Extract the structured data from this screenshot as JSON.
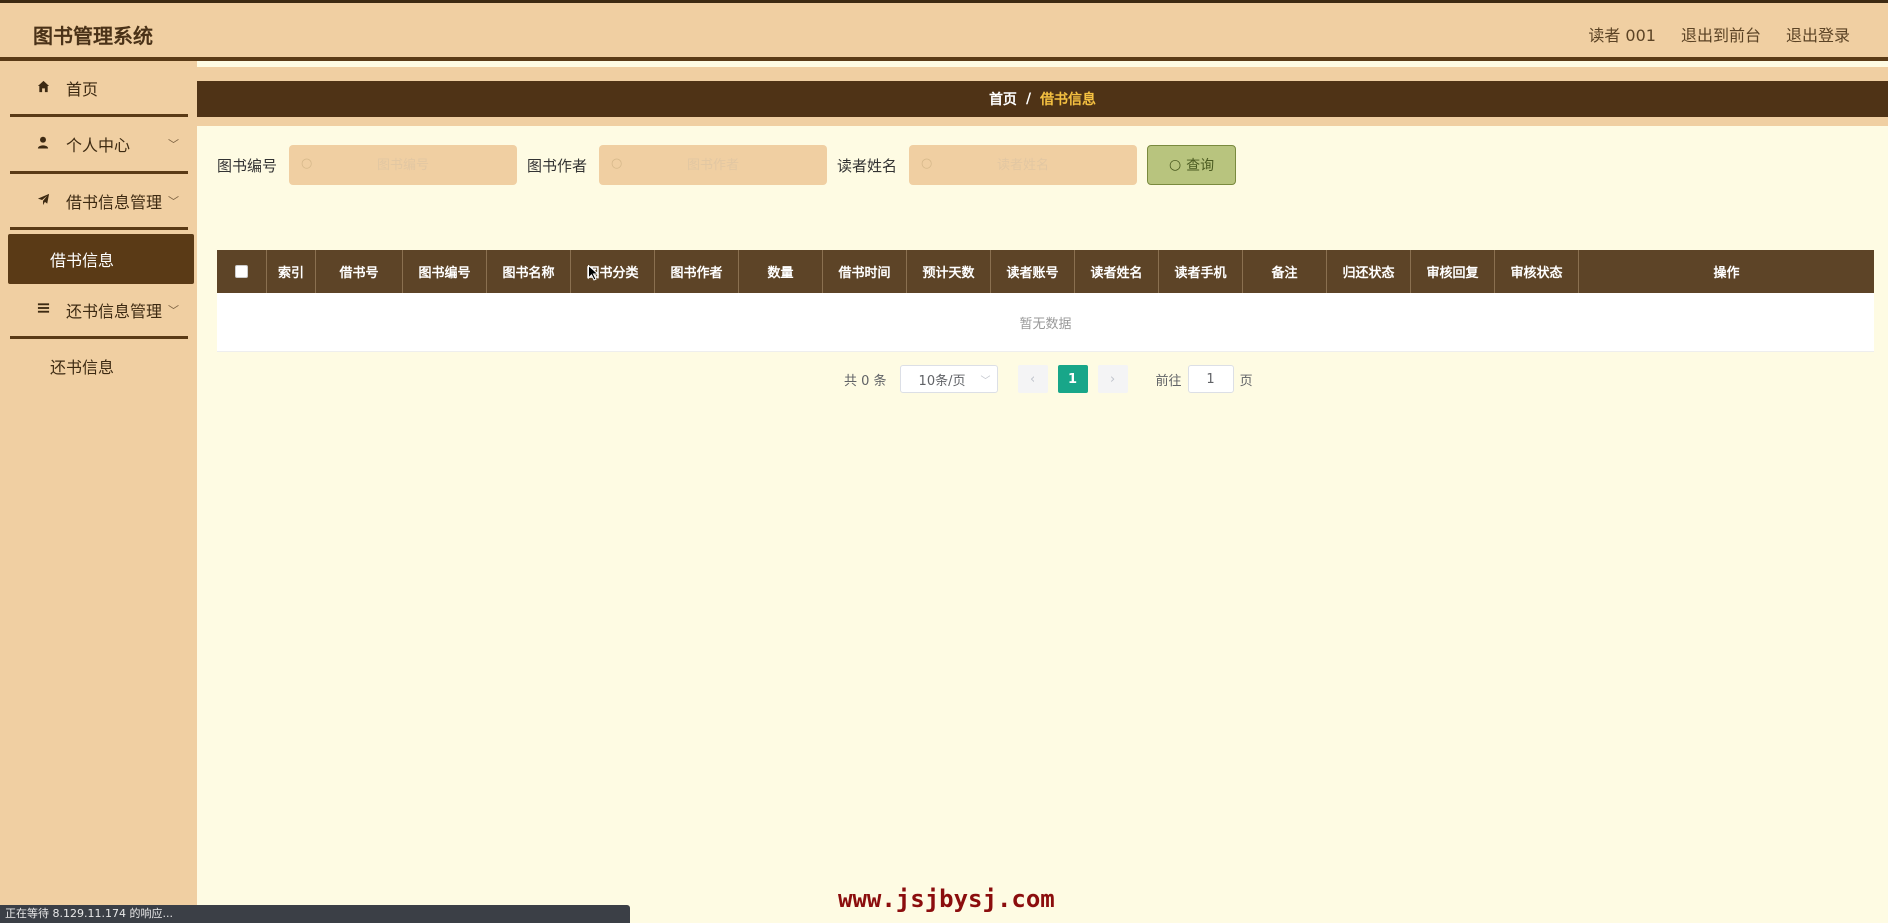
{
  "header": {
    "title": "图书管理系统",
    "links": [
      "读者 001",
      "退出到前台",
      "退出登录"
    ]
  },
  "sidebar": {
    "items": [
      {
        "label": "首页",
        "icon": "home-icon"
      },
      {
        "label": "个人中心",
        "icon": "user-icon"
      },
      {
        "label": "借书信息管理",
        "icon": "send-icon"
      },
      {
        "label": "借书信息",
        "active": true
      },
      {
        "label": "还书信息管理",
        "icon": "list-icon"
      },
      {
        "label": "还书信息"
      }
    ]
  },
  "breadcrumb": {
    "home": "首页",
    "separator": "/",
    "current": "借书信息"
  },
  "search": {
    "fields": [
      {
        "label": "图书编号",
        "placeholder": "图书编号"
      },
      {
        "label": "图书作者",
        "placeholder": "图书作者"
      },
      {
        "label": "读者姓名",
        "placeholder": "读者姓名"
      }
    ],
    "button_label": "查询"
  },
  "table": {
    "columns": [
      "索引",
      "借书号",
      "图书编号",
      "图书名称",
      "图书分类",
      "图书作者",
      "数量",
      "借书时间",
      "预计天数",
      "读者账号",
      "读者姓名",
      "读者手机",
      "备注",
      "归还状态",
      "审核回复",
      "审核状态",
      "操作"
    ],
    "empty_text": "暂无数据"
  },
  "pagination": {
    "total_text": "共 0 条",
    "page_size": "10条/页",
    "current_page": "1",
    "goto_label": "前往",
    "goto_value": "1",
    "page_suffix": "页"
  },
  "watermark": "www.jsjbysj.com",
  "statusbar": "正在等待 8.129.11.174 的响应...",
  "colors": {
    "header_bg": "#f0cfa2",
    "dark_brown": "#4f3316",
    "page_bg": "#fefbe3",
    "accent_yellow": "#f5c141",
    "page_active": "#18a689",
    "query_btn": "#b8c47e"
  }
}
